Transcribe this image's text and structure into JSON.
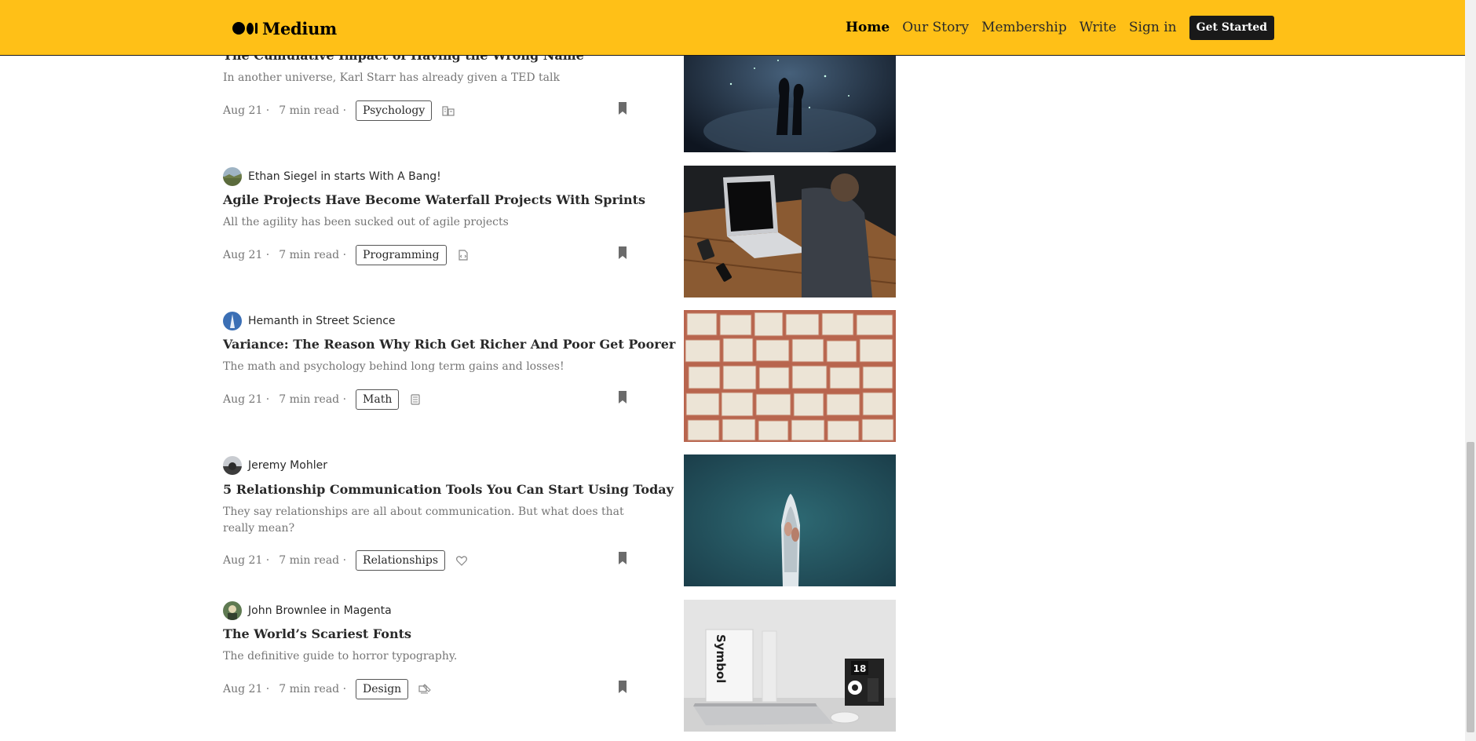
{
  "brand": {
    "name": "Medium"
  },
  "nav": {
    "home": "Home",
    "our_story": "Our Story",
    "membership": "Membership",
    "write": "Write",
    "sign_in": "Sign in",
    "get_started": "Get Started"
  },
  "colors": {
    "header_bg": "#ffc017",
    "button_bg": "#191919",
    "muted_text": "#757575"
  },
  "articles": [
    {
      "author": "",
      "title": "The Cumulative Impact of Having the Wrong Name",
      "subtitle": "In another universe, Karl Starr has already given a TED talk",
      "date": "Aug 21 ·",
      "read_time": "7 min read ·",
      "tag": "Psychology",
      "tag_icon": "buildings-icon"
    },
    {
      "author": "Ethan Siegel in starts With A Bang!",
      "title": "Agile Projects Have Become Waterfall Projects With Sprints",
      "subtitle": "All the agility has been sucked out of agile projects",
      "date": "Aug 21 ·",
      "read_time": "7 min read ·",
      "tag": "Programming",
      "tag_icon": "code-file-icon"
    },
    {
      "author": "Hemanth in Street Science",
      "title": "Variance: The Reason Why Rich Get Richer And Poor Get Poorer",
      "subtitle": "The math and psychology behind long term gains and losses!",
      "date": "Aug 21 ·",
      "read_time": "7 min read ·",
      "tag": "Math",
      "tag_icon": "calculator-icon"
    },
    {
      "author": "Jeremy Mohler",
      "title": "5 Relationship Communication Tools You Can Start Using Today",
      "subtitle": "They say relationships are all about communication. But what does that really mean?",
      "date": "Aug 21 ·",
      "read_time": "7 min read ·",
      "tag": "Relationships",
      "tag_icon": "heart-icon"
    },
    {
      "author": "John Brownlee in Magenta",
      "title": "The World’s Scariest Fonts",
      "subtitle": "The definitive guide to horror typography.",
      "date": "Aug 21 ·",
      "read_time": "7 min read ·",
      "tag": "Design",
      "tag_icon": "design-tool-icon"
    }
  ],
  "image_text": {
    "symbol_book": "Symbol",
    "calendar_day": "18"
  }
}
